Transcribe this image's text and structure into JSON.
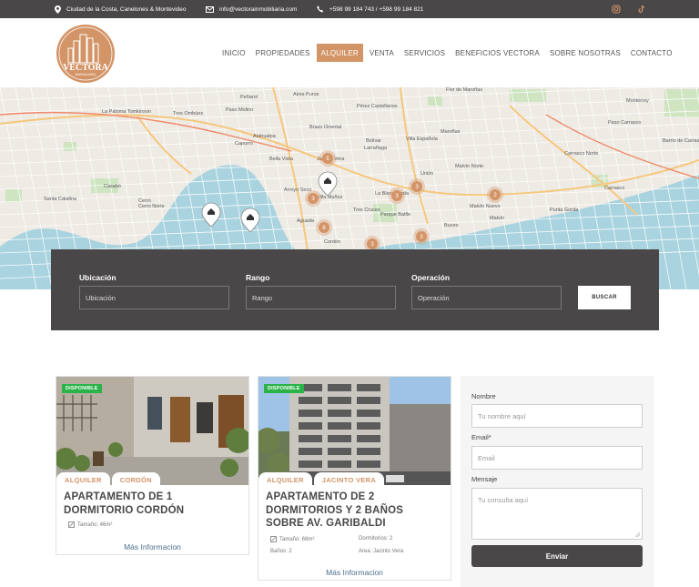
{
  "topbar": {
    "location": "Ciudad de la Costa, Canelones & Montevideo",
    "email": "info@vectorainmobiliaria.com",
    "phones": "+598 99 184 743 / +598 99 184 821"
  },
  "brand": {
    "logo_text": "VECTORA",
    "logo_sub": "INMOBILIARIA",
    "accent_color": "#d39467",
    "dark_color": "#4a4749"
  },
  "nav": {
    "items": [
      "INICIO",
      "PROPIEDADES",
      "ALQUILER",
      "VENTA",
      "SERVICIOS",
      "BENEFICIOS VECTORA",
      "SOBRE NOSOTRAS",
      "CONTACTO"
    ],
    "active": "ALQUILER"
  },
  "map": {
    "labels": [
      "Flor de Maroñas",
      "Aires Puros",
      "Peñarol",
      "Monterrey",
      "La Paloma Tomkinson",
      "Tres Ombúes",
      "Paso Molino",
      "Brazo Oriental",
      "Pérez Castellanos",
      "Maroñas",
      "Paso Carrasco",
      "Barrio de Carrasco",
      "Capurro",
      "Atahualpa",
      "Bolívar",
      "Villa Española",
      "Carrasco Norte",
      "Bella Vista",
      "Jacinto Vera",
      "Larrañaga",
      "Malvín Norte",
      "Casabó",
      "Arroyo Seco",
      "Villa Muñoz",
      "Unión",
      "Carrasco",
      "Santa Catalina",
      "Cerro",
      "Cerro Norte",
      "Tres Cruces",
      "La Blanqueada",
      "Malvín Nuevo",
      "Punta Gorda",
      "Aguada",
      "Parque Batlle",
      "Malvín",
      "Cordón",
      "Buceo"
    ],
    "cluster_counts": [
      "5",
      "3",
      "6",
      "3",
      "3",
      "2",
      "3",
      "3"
    ]
  },
  "search": {
    "fields": [
      {
        "label": "Ubicación",
        "placeholder": "Ubicación"
      },
      {
        "label": "Rango",
        "placeholder": "Rango"
      },
      {
        "label": "Operación",
        "placeholder": "Operación"
      }
    ],
    "button": "BUSCAR"
  },
  "listings": [
    {
      "badge": "DISPONIBLE",
      "tags": [
        "ALQUILER",
        "CORDÓN"
      ],
      "title": "APARTAMENTO DE 1 DORMITORIO CORDÓN",
      "features": [
        "Tamaño: 46m²"
      ],
      "more": "Más Informacion"
    },
    {
      "badge": "DISPONIBLE",
      "tags": [
        "ALQUILER",
        "JACINTO VERA"
      ],
      "title": "APARTAMENTO DE 2 DORMITORIOS Y 2 BAÑOS SOBRE AV. GARIBALDI",
      "features": [
        "Tamaño: 68m²",
        "Dormitorios: 2",
        "Baños: 2",
        "Area: Jacinto Vera"
      ],
      "more": "Más Informacion"
    }
  ],
  "contact": {
    "name_label": "Nombre",
    "name_placeholder": "Tu nombre aquí",
    "email_label": "Email*",
    "email_placeholder": "Email",
    "message_label": "Mensaje",
    "message_placeholder": "Tu consulta aquí",
    "submit": "Enviar"
  }
}
